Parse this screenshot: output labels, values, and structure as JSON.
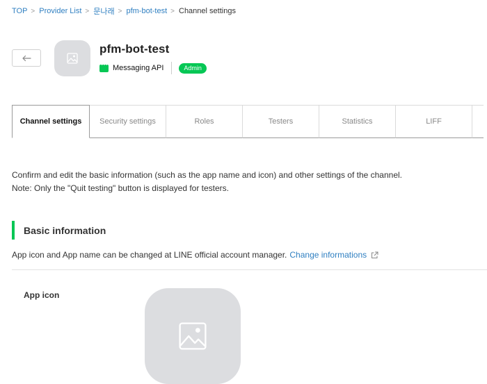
{
  "breadcrumb": {
    "items": [
      "TOP",
      "Provider List",
      "문나래",
      "pfm-bot-test"
    ],
    "current": "Channel settings"
  },
  "channel": {
    "name": "pfm-bot-test",
    "type": "Messaging API",
    "role": "Admin"
  },
  "tabs": [
    {
      "label": "Channel settings",
      "active": true
    },
    {
      "label": "Security settings"
    },
    {
      "label": "Roles"
    },
    {
      "label": "Testers"
    },
    {
      "label": "Statistics"
    },
    {
      "label": "LIFF"
    }
  ],
  "intro": {
    "line1": "Confirm and edit the basic information (such as the app name and icon) and other settings of the channel.",
    "line2": "Note: Only the \"Quit testing\" button is displayed for testers."
  },
  "basic_info": {
    "title": "Basic information",
    "desc": "App icon and App name can be changed at LINE official account manager.",
    "link": "Change informations",
    "app_icon_label": "App icon"
  },
  "colors": {
    "accent_green": "#06c755",
    "link_blue": "#2f7fc1",
    "placeholder_gray": "#dcdde0"
  },
  "icons": [
    "back-arrow-icon",
    "image-placeholder-icon",
    "chat-bubble-icon",
    "external-link-icon",
    "chevron-right-icon"
  ]
}
